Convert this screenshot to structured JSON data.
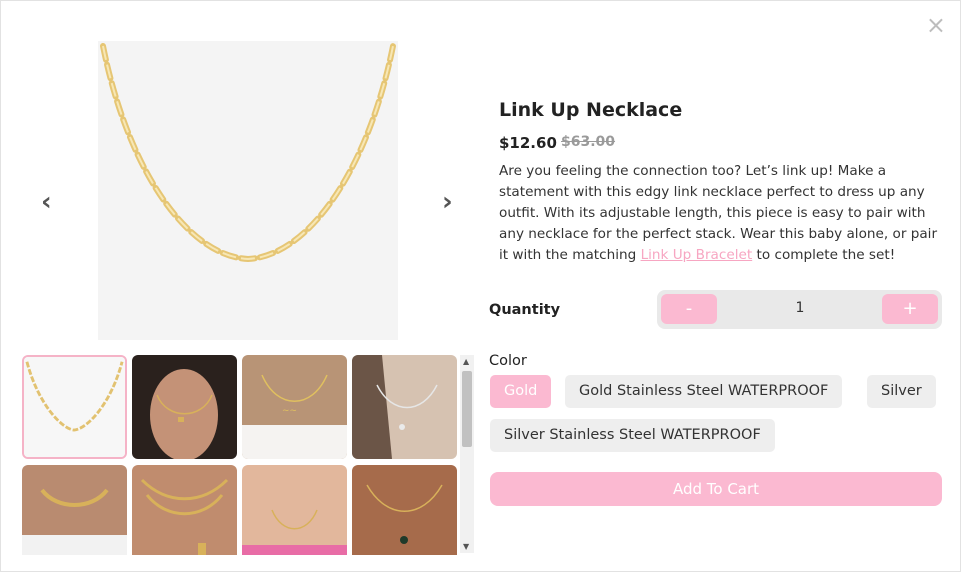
{
  "product": {
    "title": "Link Up Necklace",
    "price": "$12.60",
    "old_price": "$63.00",
    "description_before": "Are you feeling the connection too? Let’s link up! Make a statement with this edgy link necklace perfect to dress up any outfit. With its adjustable length, this piece is easy to pair with any necklace for the perfect stack. Wear this baby alone, or pair it with the matching ",
    "description_link": "Link Up Bracelet",
    "description_after": " to complete the set!"
  },
  "quantity": {
    "label": "Quantity",
    "minus": "-",
    "value": "1",
    "plus": "+"
  },
  "color": {
    "label": "Color",
    "options": [
      "Gold",
      "Gold Stainless Steel WATERPROOF",
      "Silver",
      "Silver Stainless Steel WATERPROOF"
    ],
    "selected": "Gold"
  },
  "add_to_cart": "Add To Cart",
  "nav": {
    "prev": "‹",
    "next": "›",
    "close": "×"
  },
  "colors": {
    "accent": "#fbb9d1",
    "link": "#f7a6c2",
    "muted": "#9a9a9a"
  }
}
